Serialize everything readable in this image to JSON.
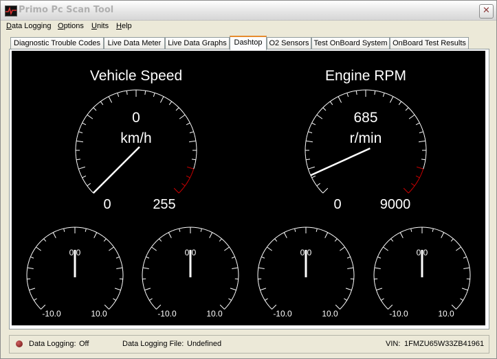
{
  "window": {
    "title": "Primo Pc  Scan Tool",
    "close_glyph": "✕"
  },
  "menu": [
    {
      "accel": "D",
      "rest": "ata Logging"
    },
    {
      "accel": "O",
      "rest": "ptions"
    },
    {
      "accel": "U",
      "rest": "nits"
    },
    {
      "accel": "H",
      "rest": "elp"
    }
  ],
  "tabs": [
    {
      "label": "Diagnostic Trouble Codes"
    },
    {
      "label": "Live Data Meter"
    },
    {
      "label": "Live Data Graphs"
    },
    {
      "label": "Dashtop",
      "active": true
    },
    {
      "label": "O2 Sensors"
    },
    {
      "label": "Test OnBoard System"
    },
    {
      "label": "OnBoard Test Results"
    }
  ],
  "gauges": {
    "speed": {
      "title": "Vehicle Speed",
      "value": "0",
      "unit": "km/h",
      "min": "0",
      "max": "255"
    },
    "rpm": {
      "title": "Engine RPM",
      "value": "685",
      "unit": "r/min",
      "min": "0",
      "max": "9000"
    },
    "small": [
      {
        "value": "0.0",
        "min": "-10.0",
        "max": "10.0"
      },
      {
        "value": "0.0",
        "min": "-10.0",
        "max": "10.0"
      },
      {
        "value": "0.0",
        "min": "-10.0",
        "max": "10.0"
      },
      {
        "value": "0.0",
        "min": "-10.0",
        "max": "10.0"
      }
    ]
  },
  "status": {
    "logging_label": "Data Logging:",
    "logging_value": "Off",
    "file_label": "Data Logging File:",
    "file_value": "Undefined",
    "vin_label": "VIN:",
    "vin_value": "1FMZU65W33ZB41961"
  },
  "colors": {
    "dash_bg": "#000000",
    "redline": "#cc0000",
    "active_tab_accent": "#e68b2c"
  }
}
